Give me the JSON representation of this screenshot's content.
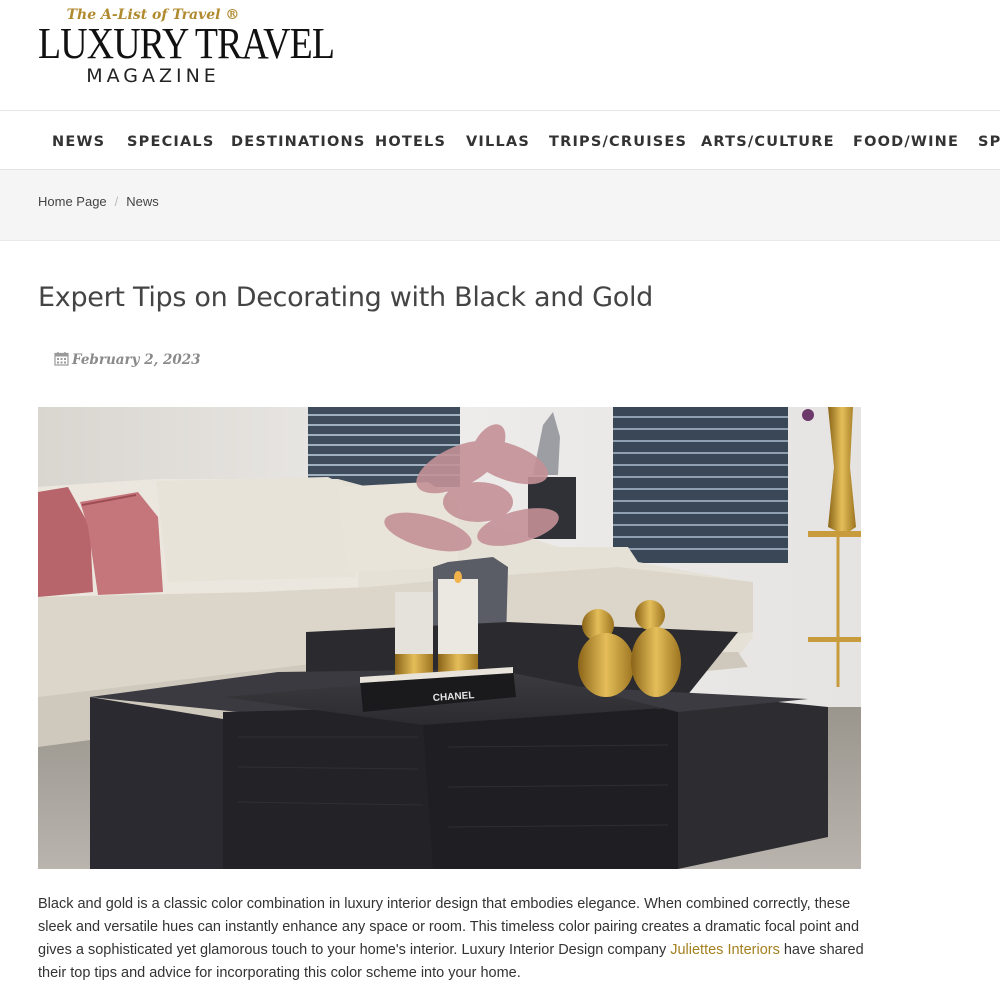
{
  "logo": {
    "tagline": "The A-List of Travel ®",
    "main": "LUXURY TRAVEL",
    "sub": "MAGAZINE"
  },
  "nav": {
    "items": [
      {
        "label": "NEWS"
      },
      {
        "label": "SPECIALS"
      },
      {
        "label": "DESTINATIONS"
      },
      {
        "label": "HOTELS"
      },
      {
        "label": "VILLAS"
      },
      {
        "label": "TRIPS/CRUISES"
      },
      {
        "label": "ARTS/CULTURE"
      },
      {
        "label": "FOOD/WINE"
      },
      {
        "label": "SPA"
      }
    ]
  },
  "breadcrumb": {
    "home": "Home Page",
    "separator": "/",
    "current": "News"
  },
  "article": {
    "title": "Expert Tips on Decorating with Black and Gold",
    "date": "February 2, 2023",
    "date_icon": "calendar-icon",
    "image_book_label": "CHANEL",
    "body_before_link": "Black and gold is a classic color combination in luxury interior design that embodies elegance. When combined correctly, these sleek and versatile hues can instantly enhance any space or room. This timeless color pairing creates a dramatic focal point and gives a sophisticated yet glamorous touch to your home's interior. Luxury Interior Design company ",
    "body_link": "Juliettes Interiors",
    "body_after_link": " have shared their top tips and advice for incorporating this color scheme into your home."
  },
  "colors": {
    "accent_gold": "#b08a2e",
    "link_gold": "#a5801f",
    "text": "#333333",
    "breadcrumb_bg": "#f5f5f5"
  }
}
